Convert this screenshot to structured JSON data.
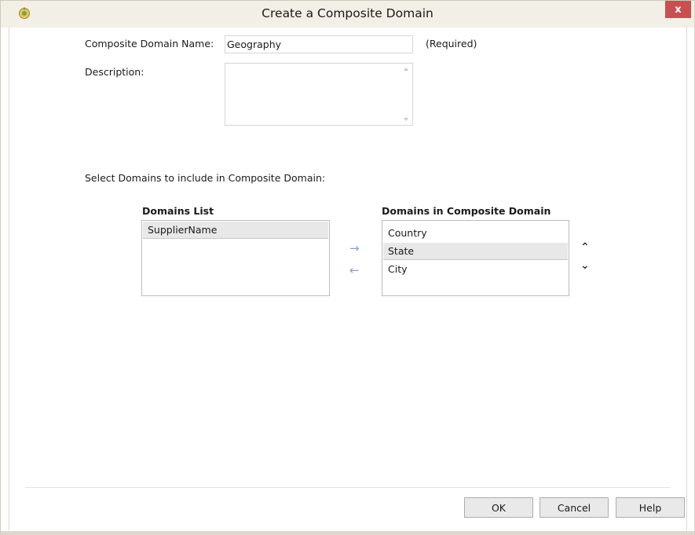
{
  "window": {
    "title": "Create a Composite Domain",
    "close_label": "x"
  },
  "form": {
    "name_label": "Composite Domain Name:",
    "name_value": "Geography",
    "required_note": "(Required)",
    "description_label": "Description:",
    "description_value": "",
    "select_label": "Select Domains to include in Composite Domain:"
  },
  "domains_list": {
    "header": "Domains List",
    "items": [
      {
        "label": "SupplierName",
        "selected": true
      }
    ]
  },
  "composite_list": {
    "header": "Domains in Composite Domain",
    "items": [
      {
        "label": "Country",
        "selected": false
      },
      {
        "label": "State",
        "selected": true
      },
      {
        "label": "City",
        "selected": false
      }
    ]
  },
  "transfer": {
    "add_glyph": "→",
    "remove_glyph": "←",
    "up_glyph": "⌃",
    "down_glyph": "⌄"
  },
  "buttons": {
    "ok": "OK",
    "cancel": "Cancel",
    "help": "Help"
  },
  "colors": {
    "titlebar": "#f2efe6",
    "close": "#c75050",
    "selection": "#e8e8e8",
    "arrows": "#8aa2c4"
  }
}
